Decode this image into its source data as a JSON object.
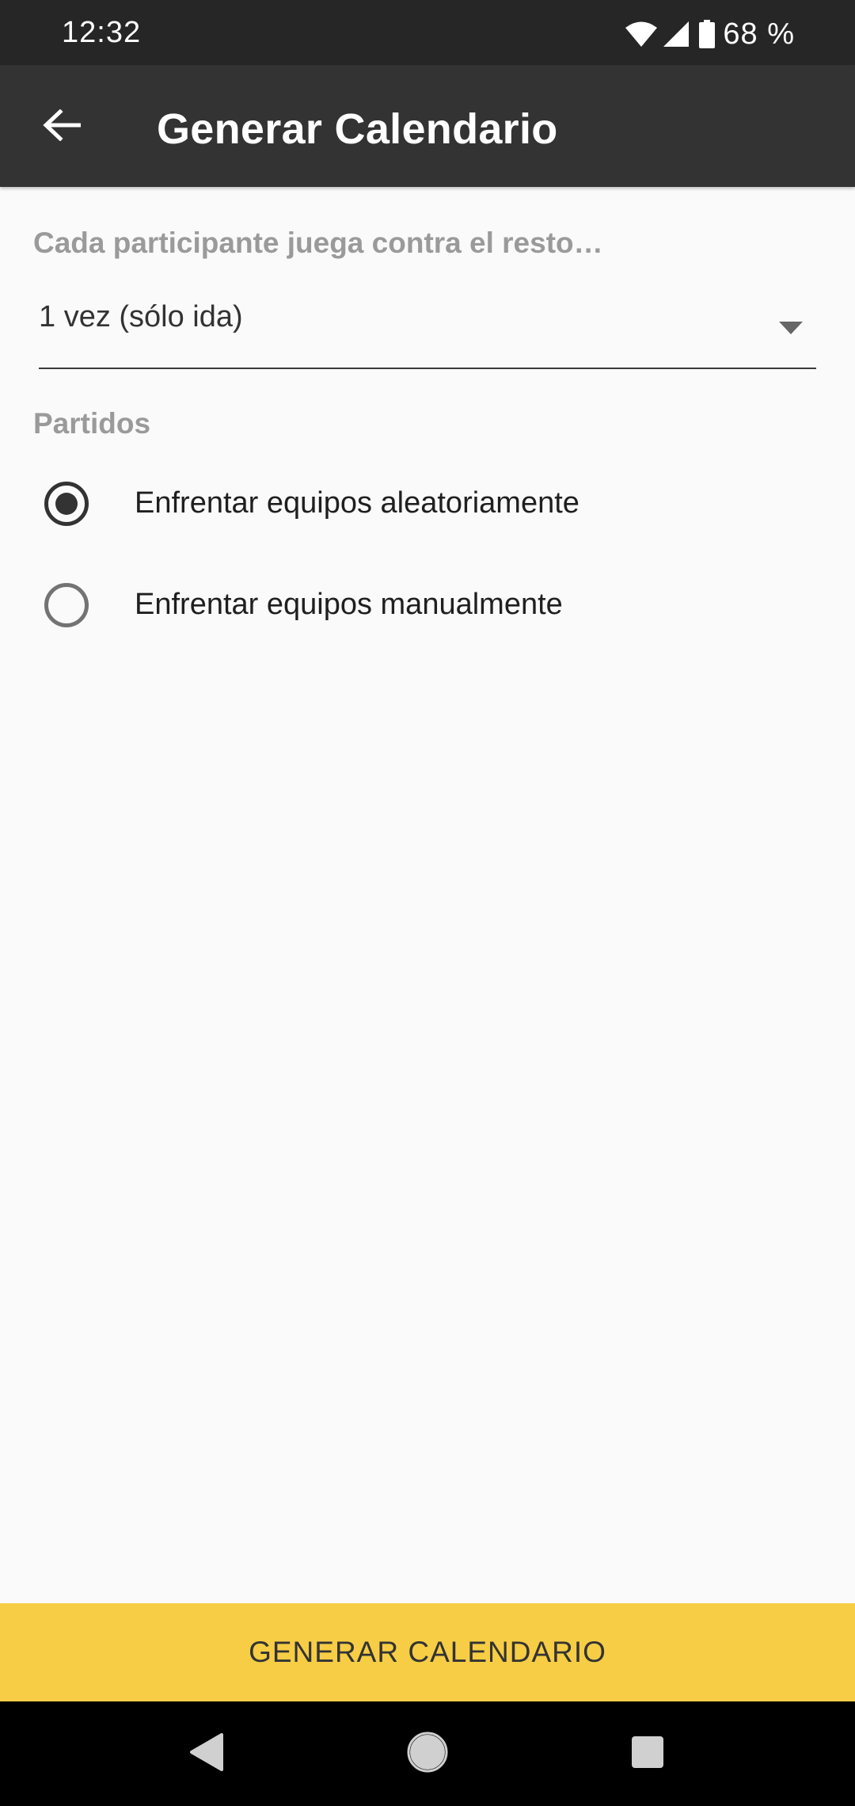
{
  "status_bar": {
    "time": "12:32",
    "battery": "68 %",
    "icons": [
      "wifi-icon",
      "signal-icon",
      "battery-icon"
    ]
  },
  "app_bar": {
    "title": "Generar Calendario",
    "back_icon": "arrow-back-icon"
  },
  "rounds": {
    "label": "Cada participante juega contra el resto…",
    "selected": "1 vez (sólo ida)"
  },
  "matches": {
    "label": "Partidos",
    "options": [
      {
        "label": "Enfrentar equipos aleatoriamente",
        "checked": true
      },
      {
        "label": "Enfrentar equipos manualmente",
        "checked": false
      }
    ]
  },
  "actions": {
    "generate_label": "GENERAR CALENDARIO"
  },
  "nav_bar": {
    "icons": [
      "back-triangle-icon",
      "home-circle-icon",
      "recents-square-icon"
    ]
  },
  "colors": {
    "status_bar": "#262626",
    "app_bar": "#333333",
    "background": "#fafafa",
    "accent_button": "#f7cd45",
    "section_label": "#9a9a9a"
  }
}
